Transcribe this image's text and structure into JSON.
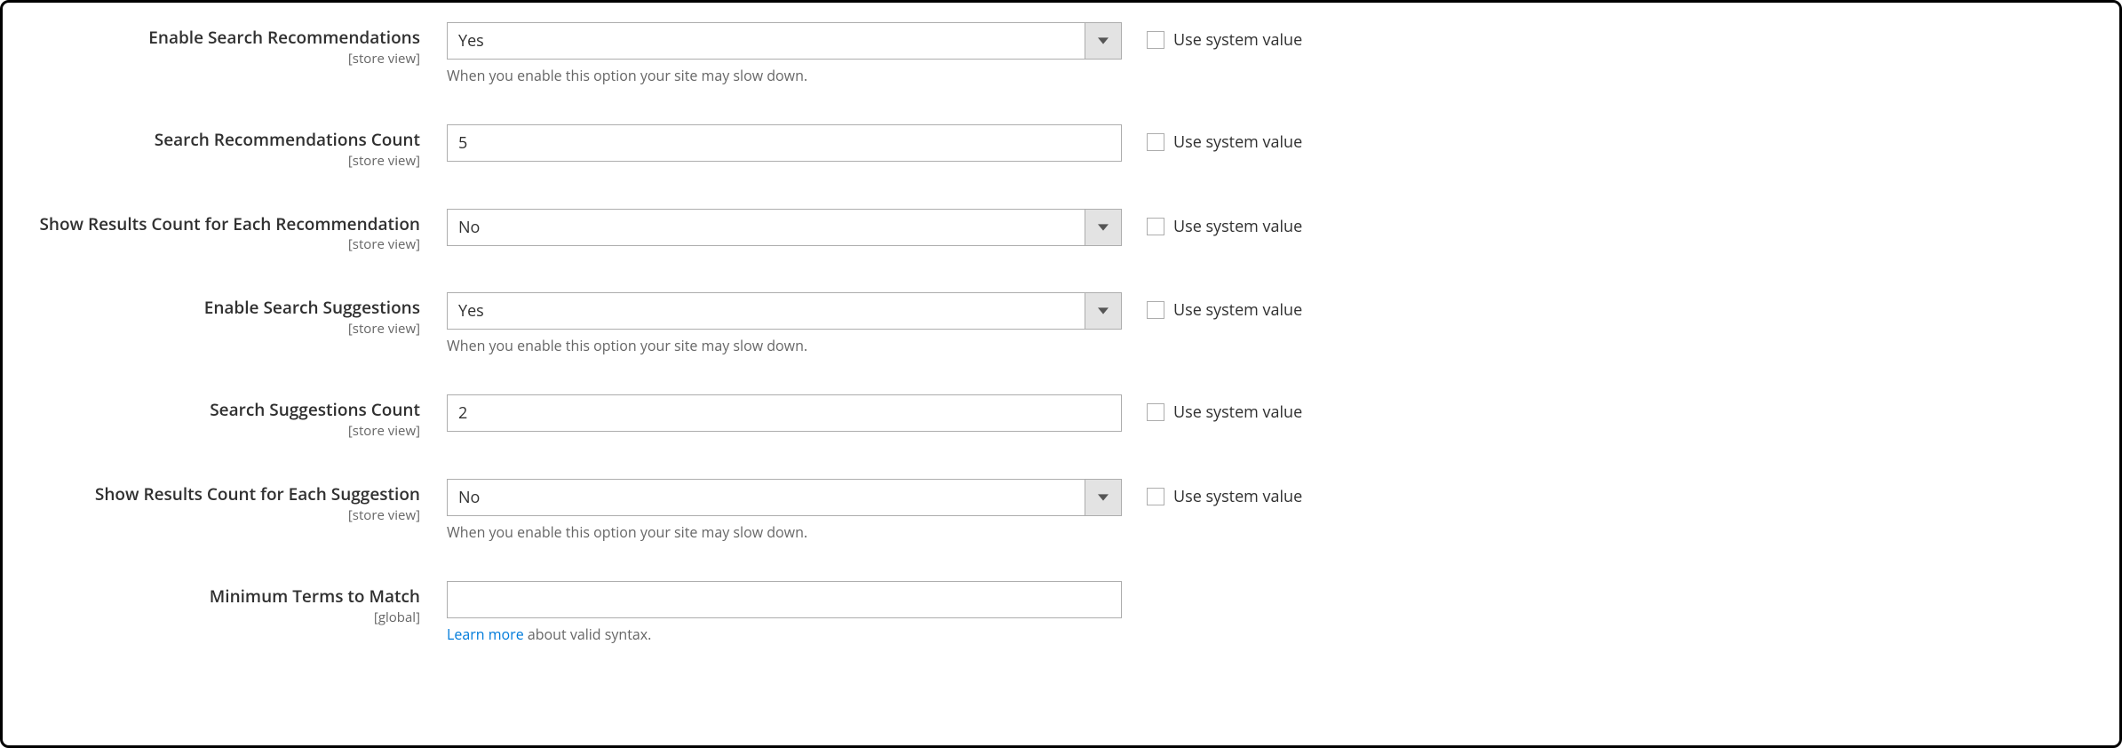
{
  "common": {
    "scope_store": "[store view]",
    "scope_global": "[global]",
    "use_system_value": "Use system value",
    "slowdown_note": "When you enable this option your site may slow down."
  },
  "fields": {
    "enable_recommendations": {
      "label": "Enable Search Recommendations",
      "value": "Yes",
      "has_note": true,
      "has_inherit": true
    },
    "recommendations_count": {
      "label": "Search Recommendations Count",
      "value": "5",
      "has_inherit": true
    },
    "show_results_each_recommendation": {
      "label": "Show Results Count for Each Recommendation",
      "value": "No",
      "has_inherit": true
    },
    "enable_suggestions": {
      "label": "Enable Search Suggestions",
      "value": "Yes",
      "has_note": true,
      "has_inherit": true
    },
    "suggestions_count": {
      "label": "Search Suggestions Count",
      "value": "2",
      "has_inherit": true
    },
    "show_results_each_suggestion": {
      "label": "Show Results Count for Each Suggestion",
      "value": "No",
      "has_note": true,
      "has_inherit": true
    },
    "minimum_terms": {
      "label": "Minimum Terms to Match",
      "value": "",
      "note_link": "Learn more",
      "note_rest": " about valid syntax."
    }
  }
}
